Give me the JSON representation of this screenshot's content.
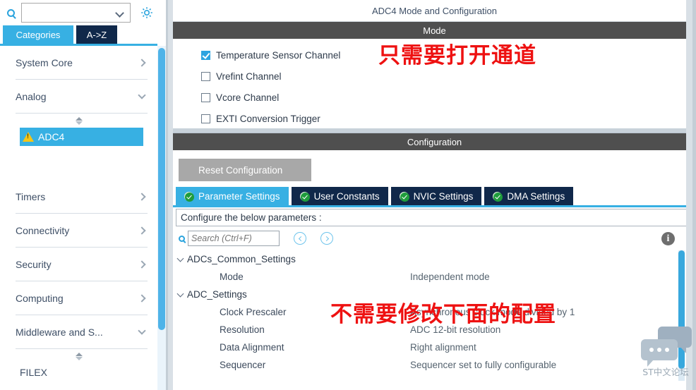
{
  "sidebar": {
    "search": {
      "value": "",
      "placeholder": "",
      "icon": "search-icon"
    },
    "gear": {
      "icon": "gear-icon"
    },
    "tabs": [
      {
        "label": "Categories",
        "active": true
      },
      {
        "label": "A->Z",
        "active": false
      }
    ],
    "categories": [
      {
        "label": "System Core",
        "expanded": false
      },
      {
        "label": "Analog",
        "expanded": true
      },
      {
        "label": "Timers",
        "expanded": false
      },
      {
        "label": "Connectivity",
        "expanded": false
      },
      {
        "label": "Security",
        "expanded": false
      },
      {
        "label": "Computing",
        "expanded": false
      },
      {
        "label": "Middleware and S...",
        "expanded": true
      }
    ],
    "analog_children": [
      {
        "label": "ADC4",
        "selected": true,
        "icon": "warning-triangle-icon"
      }
    ],
    "middleware_children": [
      {
        "label": "FILEX",
        "selected": false
      }
    ]
  },
  "main": {
    "panel_title": "ADC4 Mode and Configuration",
    "mode_section": {
      "header": "Mode",
      "checkboxes": [
        {
          "label": "Temperature Sensor Channel",
          "checked": true
        },
        {
          "label": "Vrefint Channel",
          "checked": false
        },
        {
          "label": "Vcore Channel",
          "checked": false
        },
        {
          "label": "EXTI Conversion Trigger",
          "checked": false
        }
      ]
    },
    "config_section": {
      "header": "Configuration",
      "reset_button": "Reset Configuration",
      "tabs": [
        {
          "label": "Parameter Settings",
          "active": true,
          "icon": "check-circle-icon"
        },
        {
          "label": "User Constants",
          "active": false,
          "icon": "check-circle-icon"
        },
        {
          "label": "NVIC Settings",
          "active": false,
          "icon": "check-circle-icon"
        },
        {
          "label": "DMA Settings",
          "active": false,
          "icon": "check-circle-icon"
        }
      ],
      "configure_hint": "Configure the below parameters :",
      "search": {
        "value": "",
        "placeholder": "Search (Ctrl+F)",
        "icon": "search-icon"
      },
      "prev_button": "prev-icon",
      "next_button": "next-icon",
      "info_button": "info-icon",
      "tree": [
        {
          "type": "group",
          "name": "ADCs_Common_Settings",
          "expanded": true
        },
        {
          "type": "param",
          "name": "Mode",
          "value": "Independent mode"
        },
        {
          "type": "group",
          "name": "ADC_Settings",
          "expanded": true
        },
        {
          "type": "param",
          "name": "Clock Prescaler",
          "value": "Asynchronous clock mode divided by 1"
        },
        {
          "type": "param",
          "name": "Resolution",
          "value": "ADC 12-bit resolution"
        },
        {
          "type": "param",
          "name": "Data Alignment",
          "value": "Right alignment"
        },
        {
          "type": "param",
          "name": "Sequencer",
          "value": "Sequencer set to fully configurable"
        }
      ]
    }
  },
  "annotations": [
    {
      "text": "只需要打开通道",
      "color": "#ee1111"
    },
    {
      "text": "不需要修改下面的配置",
      "color": "#ee1111"
    }
  ],
  "watermark": {
    "text": "ST中文论坛"
  }
}
